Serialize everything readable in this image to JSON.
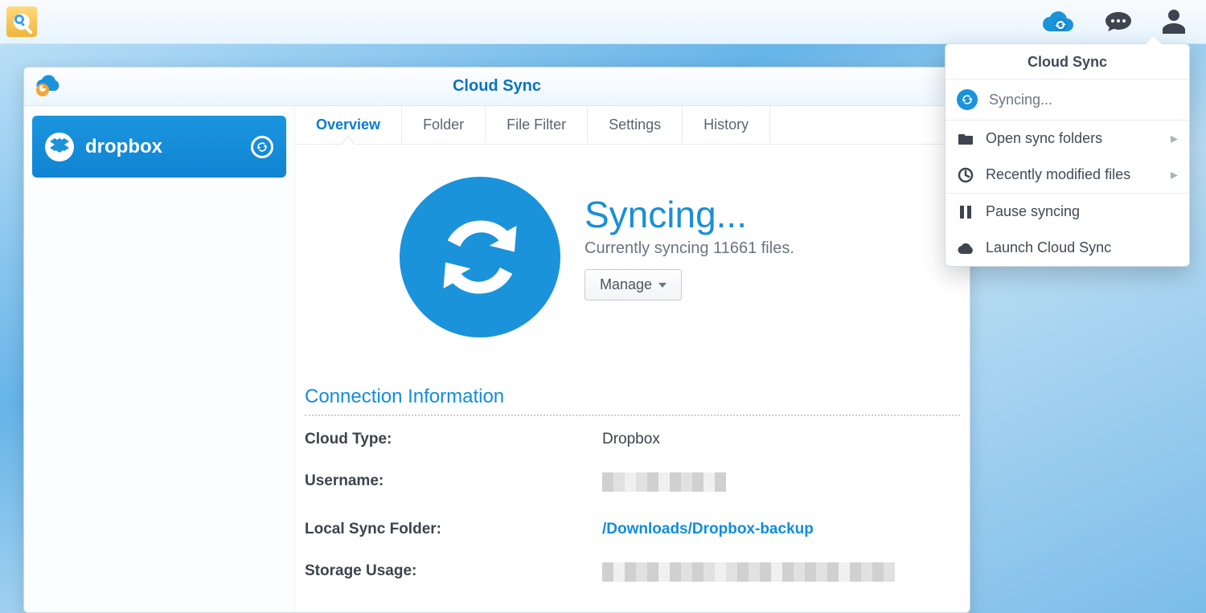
{
  "topbar": {
    "icons": {
      "cloud": "cloud-sync-icon",
      "chat": "chat-icon",
      "user": "user-icon",
      "search": "search-icon"
    }
  },
  "window": {
    "title": "Cloud Sync",
    "sidebar": {
      "connection": {
        "name": "dropbox"
      }
    },
    "tabs": [
      "Overview",
      "Folder",
      "File Filter",
      "Settings",
      "History"
    ],
    "active_tab": "Overview",
    "status": {
      "heading": "Syncing...",
      "subtext": "Currently syncing 11661 files.",
      "manage_label": "Manage"
    },
    "conn_info": {
      "section_title": "Connection Information",
      "rows": {
        "cloud_type": {
          "label": "Cloud Type:",
          "value": "Dropbox"
        },
        "username": {
          "label": "Username:",
          "redacted": true
        },
        "local_path": {
          "label": "Local Sync Folder:",
          "value": "/Downloads/Dropbox-backup"
        },
        "storage": {
          "label": "Storage Usage:",
          "redacted": true
        }
      }
    }
  },
  "popover": {
    "title": "Cloud Sync",
    "status": "Syncing...",
    "items": {
      "open_folders": "Open sync folders",
      "recent_files": "Recently modified files",
      "pause": "Pause syncing",
      "launch": "Launch Cloud Sync"
    }
  }
}
